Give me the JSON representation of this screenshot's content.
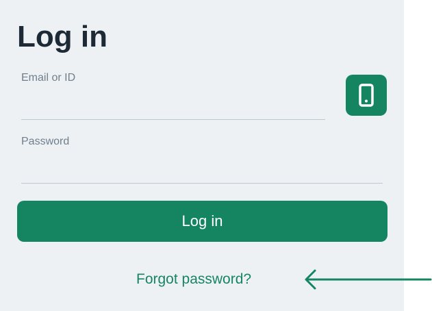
{
  "login": {
    "title": "Log in",
    "email_label": "Email or ID",
    "email_value": "",
    "password_label": "Password",
    "password_value": "",
    "submit_label": "Log in",
    "forgot_label": "Forgot password?"
  },
  "icons": {
    "phone_button": "smartphone-icon",
    "annotation": "arrow-left-icon"
  },
  "colors": {
    "accent": "#158561",
    "panel_bg": "#eef1f4",
    "title_text": "#1d2a35",
    "label_text": "#6f7f8c"
  }
}
